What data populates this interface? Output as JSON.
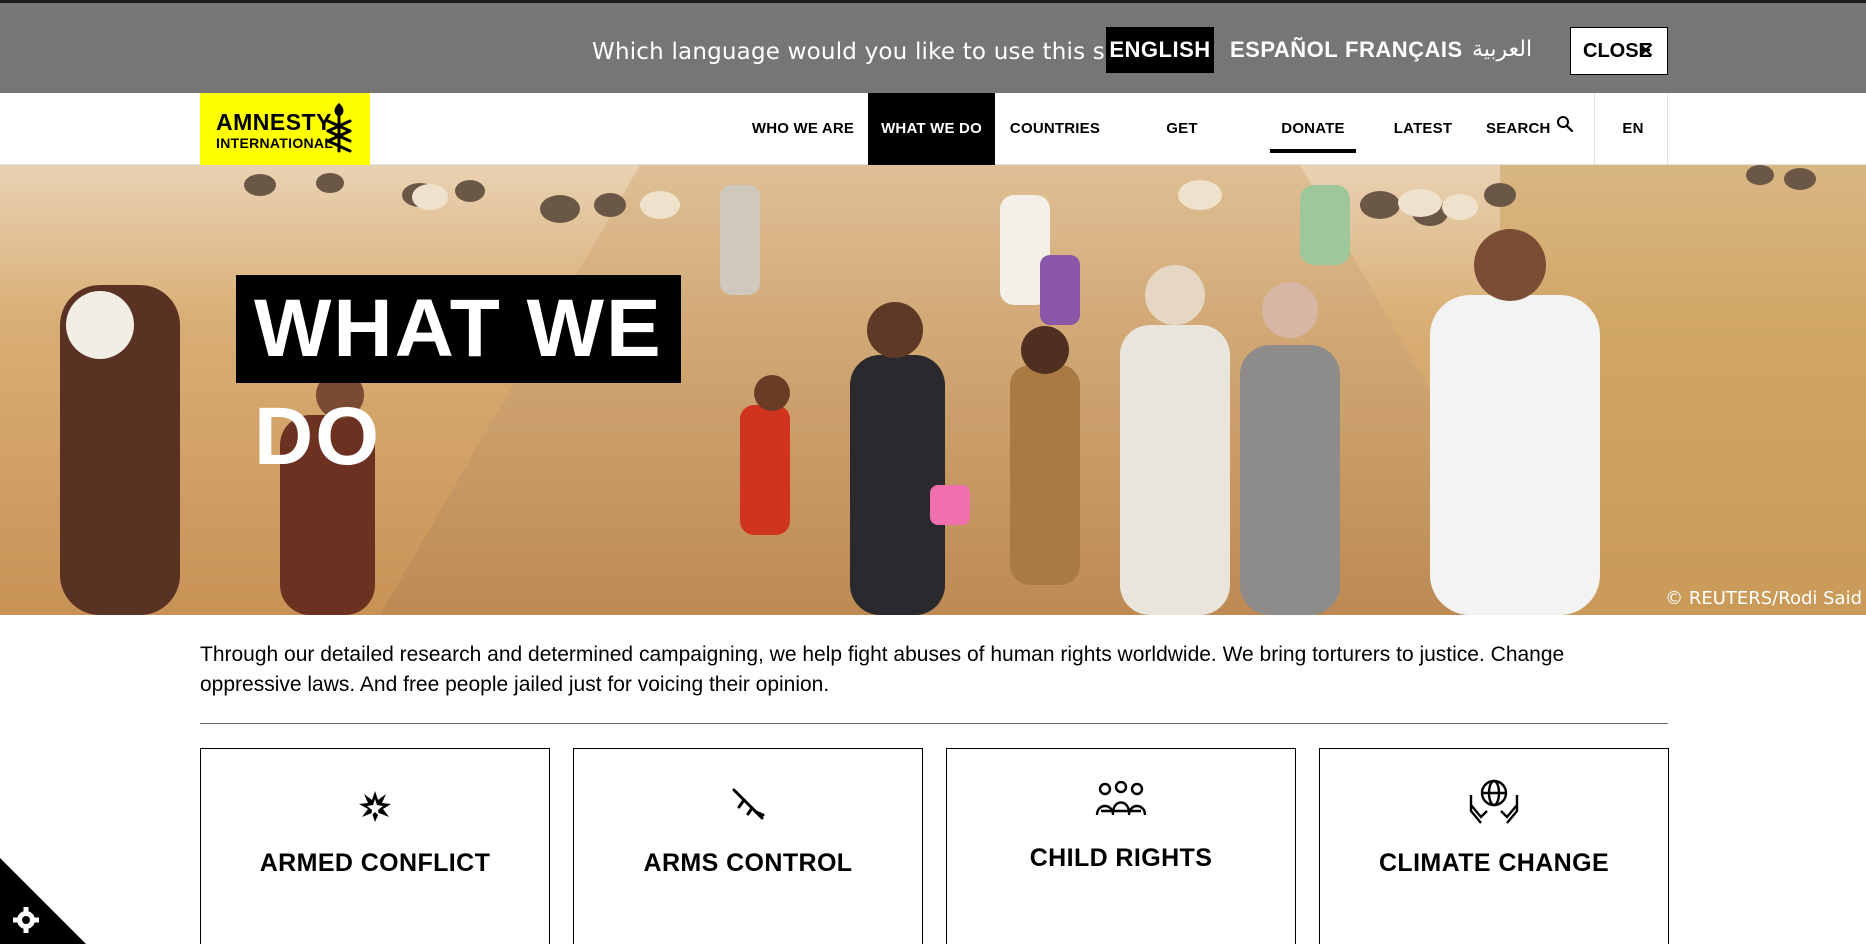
{
  "language_bar": {
    "question": "Which language would you like to use this site in?",
    "languages": [
      "ENGLISH",
      "ESPAÑOL",
      "FRANÇAIS",
      "العربية"
    ],
    "active_language": "ENGLISH",
    "close_label": "CLOSE",
    "close_icon": "close-icon"
  },
  "header": {
    "logo_line1": "AMNESTY",
    "logo_line2": "INTERNATIONAL",
    "nav": [
      "WHO WE ARE",
      "WHAT WE DO",
      "COUNTRIES",
      "GET INVOLVED",
      "DONATE NOW",
      "LATEST",
      "SEARCH"
    ],
    "active_nav": "WHAT WE DO",
    "lang_code": "EN"
  },
  "hero": {
    "title": "WHAT WE DO",
    "credit": "© REUTERS/Rodi Said"
  },
  "intro": {
    "text": "Through our detailed research and determined campaigning, we help fight abuses of human rights worldwide. We bring torturers to justice. Change oppressive laws. And free people jailed just for voicing their opinion."
  },
  "cards": [
    {
      "label": "ARMED CONFLICT",
      "icon": "explosion-icon"
    },
    {
      "label": "ARMS CONTROL",
      "icon": "rifle-icon"
    },
    {
      "label": "CHILD RIGHTS",
      "icon": "children-icon"
    },
    {
      "label": "CLIMATE CHANGE",
      "icon": "globe-hands-icon"
    }
  ],
  "colors": {
    "brand_yellow": "#ffff00",
    "language_bar": "#767676",
    "active_nav": "#000000"
  }
}
